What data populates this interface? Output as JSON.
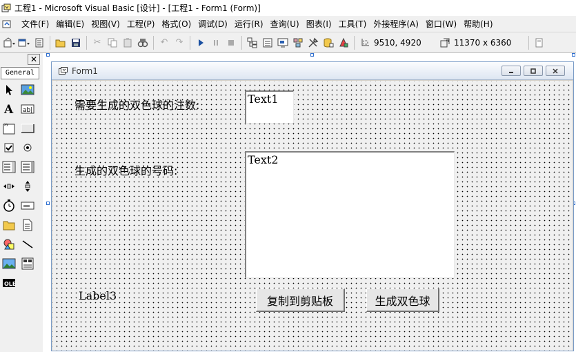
{
  "window": {
    "title": "工程1 - Microsoft Visual Basic [设计] - [工程1 - Form1 (Form)]"
  },
  "menu": [
    "文件(F)",
    "编辑(E)",
    "视图(V)",
    "工程(P)",
    "格式(O)",
    "调试(D)",
    "运行(R)",
    "查询(U)",
    "图表(I)",
    "工具(T)",
    "外接程序(A)",
    "窗口(W)",
    "帮助(H)"
  ],
  "toolbar": {
    "position": "9510, 4920",
    "size": "11370 x 6360"
  },
  "toolbox": {
    "tab": "General",
    "close": "✕"
  },
  "form": {
    "title": "Form1",
    "label1": "需要生成的双色球的注数:",
    "text1": "Text1",
    "label2": "生成的双色球的号码:",
    "text2": "Text2",
    "label3": "Label3",
    "button_copy": "复制到剪贴板",
    "button_generate": "生成双色球"
  },
  "colors": {
    "form_border": "#7a9cc7",
    "selection_handle": "#3070d0",
    "form_bg": "#f0f0f0"
  }
}
